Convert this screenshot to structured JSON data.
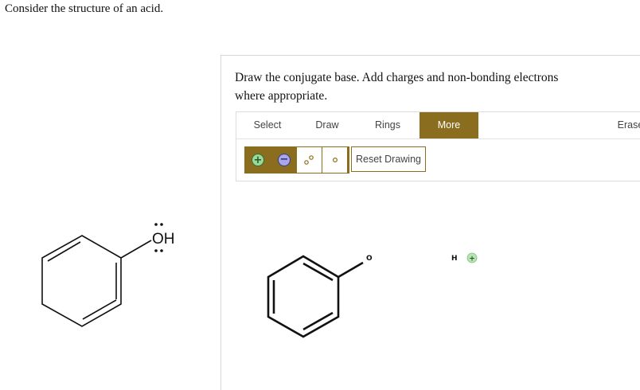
{
  "question": "Consider the structure of an acid.",
  "reference_molecule": {
    "group_label": "OH"
  },
  "panel": {
    "instructions": "Draw the conjugate base. Add charges and non-bonding electrons where appropriate."
  },
  "toolbar": {
    "tabs": [
      {
        "label": "Select"
      },
      {
        "label": "Draw"
      },
      {
        "label": "Rings"
      },
      {
        "label": "More"
      },
      {
        "label": "Erase"
      }
    ],
    "active_tab": "More",
    "reset_label": "Reset Drawing",
    "tools": [
      "positive-charge",
      "negative-charge",
      "lone-pair",
      "radical"
    ]
  },
  "canvas": {
    "oxygen_label": "O",
    "hydrogen_label": "H",
    "hydrogen_charge": "+"
  },
  "colors": {
    "accent": "#8a6d1f",
    "plus": "#9fd79b",
    "minus": "#a9a7e8"
  }
}
